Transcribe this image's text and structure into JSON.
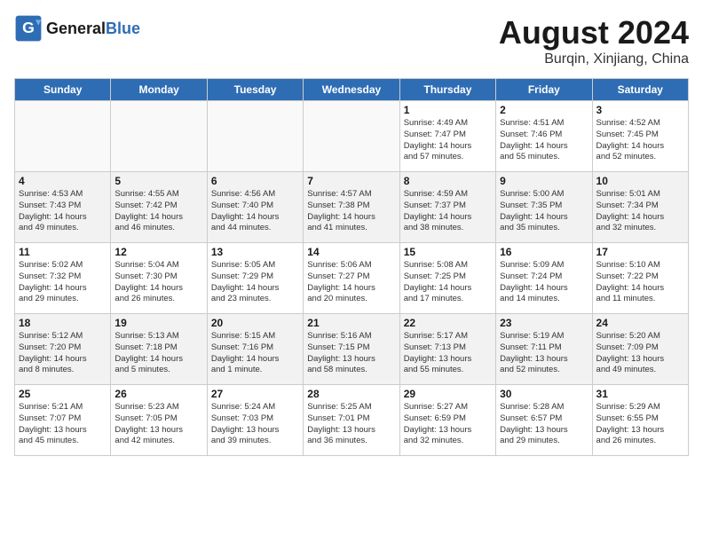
{
  "logo": {
    "text_general": "General",
    "text_blue": "Blue"
  },
  "header": {
    "month": "August 2024",
    "location": "Burqin, Xinjiang, China"
  },
  "days_of_week": [
    "Sunday",
    "Monday",
    "Tuesday",
    "Wednesday",
    "Thursday",
    "Friday",
    "Saturday"
  ],
  "weeks": [
    [
      {
        "day": "",
        "info": ""
      },
      {
        "day": "",
        "info": ""
      },
      {
        "day": "",
        "info": ""
      },
      {
        "day": "",
        "info": ""
      },
      {
        "day": "1",
        "info": "Sunrise: 4:49 AM\nSunset: 7:47 PM\nDaylight: 14 hours\nand 57 minutes."
      },
      {
        "day": "2",
        "info": "Sunrise: 4:51 AM\nSunset: 7:46 PM\nDaylight: 14 hours\nand 55 minutes."
      },
      {
        "day": "3",
        "info": "Sunrise: 4:52 AM\nSunset: 7:45 PM\nDaylight: 14 hours\nand 52 minutes."
      }
    ],
    [
      {
        "day": "4",
        "info": "Sunrise: 4:53 AM\nSunset: 7:43 PM\nDaylight: 14 hours\nand 49 minutes."
      },
      {
        "day": "5",
        "info": "Sunrise: 4:55 AM\nSunset: 7:42 PM\nDaylight: 14 hours\nand 46 minutes."
      },
      {
        "day": "6",
        "info": "Sunrise: 4:56 AM\nSunset: 7:40 PM\nDaylight: 14 hours\nand 44 minutes."
      },
      {
        "day": "7",
        "info": "Sunrise: 4:57 AM\nSunset: 7:38 PM\nDaylight: 14 hours\nand 41 minutes."
      },
      {
        "day": "8",
        "info": "Sunrise: 4:59 AM\nSunset: 7:37 PM\nDaylight: 14 hours\nand 38 minutes."
      },
      {
        "day": "9",
        "info": "Sunrise: 5:00 AM\nSunset: 7:35 PM\nDaylight: 14 hours\nand 35 minutes."
      },
      {
        "day": "10",
        "info": "Sunrise: 5:01 AM\nSunset: 7:34 PM\nDaylight: 14 hours\nand 32 minutes."
      }
    ],
    [
      {
        "day": "11",
        "info": "Sunrise: 5:02 AM\nSunset: 7:32 PM\nDaylight: 14 hours\nand 29 minutes."
      },
      {
        "day": "12",
        "info": "Sunrise: 5:04 AM\nSunset: 7:30 PM\nDaylight: 14 hours\nand 26 minutes."
      },
      {
        "day": "13",
        "info": "Sunrise: 5:05 AM\nSunset: 7:29 PM\nDaylight: 14 hours\nand 23 minutes."
      },
      {
        "day": "14",
        "info": "Sunrise: 5:06 AM\nSunset: 7:27 PM\nDaylight: 14 hours\nand 20 minutes."
      },
      {
        "day": "15",
        "info": "Sunrise: 5:08 AM\nSunset: 7:25 PM\nDaylight: 14 hours\nand 17 minutes."
      },
      {
        "day": "16",
        "info": "Sunrise: 5:09 AM\nSunset: 7:24 PM\nDaylight: 14 hours\nand 14 minutes."
      },
      {
        "day": "17",
        "info": "Sunrise: 5:10 AM\nSunset: 7:22 PM\nDaylight: 14 hours\nand 11 minutes."
      }
    ],
    [
      {
        "day": "18",
        "info": "Sunrise: 5:12 AM\nSunset: 7:20 PM\nDaylight: 14 hours\nand 8 minutes."
      },
      {
        "day": "19",
        "info": "Sunrise: 5:13 AM\nSunset: 7:18 PM\nDaylight: 14 hours\nand 5 minutes."
      },
      {
        "day": "20",
        "info": "Sunrise: 5:15 AM\nSunset: 7:16 PM\nDaylight: 14 hours\nand 1 minute."
      },
      {
        "day": "21",
        "info": "Sunrise: 5:16 AM\nSunset: 7:15 PM\nDaylight: 13 hours\nand 58 minutes."
      },
      {
        "day": "22",
        "info": "Sunrise: 5:17 AM\nSunset: 7:13 PM\nDaylight: 13 hours\nand 55 minutes."
      },
      {
        "day": "23",
        "info": "Sunrise: 5:19 AM\nSunset: 7:11 PM\nDaylight: 13 hours\nand 52 minutes."
      },
      {
        "day": "24",
        "info": "Sunrise: 5:20 AM\nSunset: 7:09 PM\nDaylight: 13 hours\nand 49 minutes."
      }
    ],
    [
      {
        "day": "25",
        "info": "Sunrise: 5:21 AM\nSunset: 7:07 PM\nDaylight: 13 hours\nand 45 minutes."
      },
      {
        "day": "26",
        "info": "Sunrise: 5:23 AM\nSunset: 7:05 PM\nDaylight: 13 hours\nand 42 minutes."
      },
      {
        "day": "27",
        "info": "Sunrise: 5:24 AM\nSunset: 7:03 PM\nDaylight: 13 hours\nand 39 minutes."
      },
      {
        "day": "28",
        "info": "Sunrise: 5:25 AM\nSunset: 7:01 PM\nDaylight: 13 hours\nand 36 minutes."
      },
      {
        "day": "29",
        "info": "Sunrise: 5:27 AM\nSunset: 6:59 PM\nDaylight: 13 hours\nand 32 minutes."
      },
      {
        "day": "30",
        "info": "Sunrise: 5:28 AM\nSunset: 6:57 PM\nDaylight: 13 hours\nand 29 minutes."
      },
      {
        "day": "31",
        "info": "Sunrise: 5:29 AM\nSunset: 6:55 PM\nDaylight: 13 hours\nand 26 minutes."
      }
    ]
  ]
}
